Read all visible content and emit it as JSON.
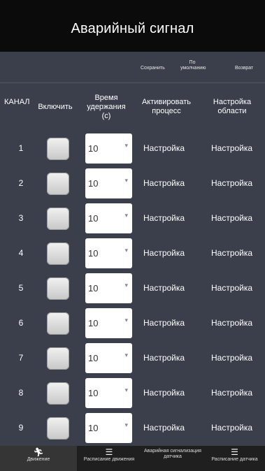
{
  "header": {
    "title": "Аварийный сигнал"
  },
  "actions": {
    "save": "Сохранить",
    "default": "По умолчанию",
    "back": "Возврат"
  },
  "columns": {
    "channel": "КАНАЛ",
    "enable": "Включить",
    "hold_time": "Время удержания (с)",
    "activate": "Активировать процесс",
    "area": "Настройка области"
  },
  "rows": [
    {
      "num": "1",
      "value": "10",
      "activate": "Настройка",
      "area": "Настройка"
    },
    {
      "num": "2",
      "value": "10",
      "activate": "Настройка",
      "area": "Настройка"
    },
    {
      "num": "3",
      "value": "10",
      "activate": "Настройка",
      "area": "Настройка"
    },
    {
      "num": "4",
      "value": "10",
      "activate": "Настройка",
      "area": "Настройка"
    },
    {
      "num": "5",
      "value": "10",
      "activate": "Настройка",
      "area": "Настройка"
    },
    {
      "num": "6",
      "value": "10",
      "activate": "Настройка",
      "area": "Настройка"
    },
    {
      "num": "7",
      "value": "10",
      "activate": "Настройка",
      "area": "Настройка"
    },
    {
      "num": "8",
      "value": "10",
      "activate": "Настройка",
      "area": "Настройка"
    },
    {
      "num": "9",
      "value": "10",
      "activate": "Настройка",
      "area": "Настройка"
    }
  ],
  "tabs": [
    {
      "label": "Движение",
      "icon": "running-person-icon"
    },
    {
      "label": "Расписание движения",
      "icon": "schedule-icon"
    },
    {
      "label": "Аварийная сигнализация датчика",
      "icon": "alarm-icon"
    },
    {
      "label": "Расписание датчика",
      "icon": "schedule-icon"
    }
  ]
}
